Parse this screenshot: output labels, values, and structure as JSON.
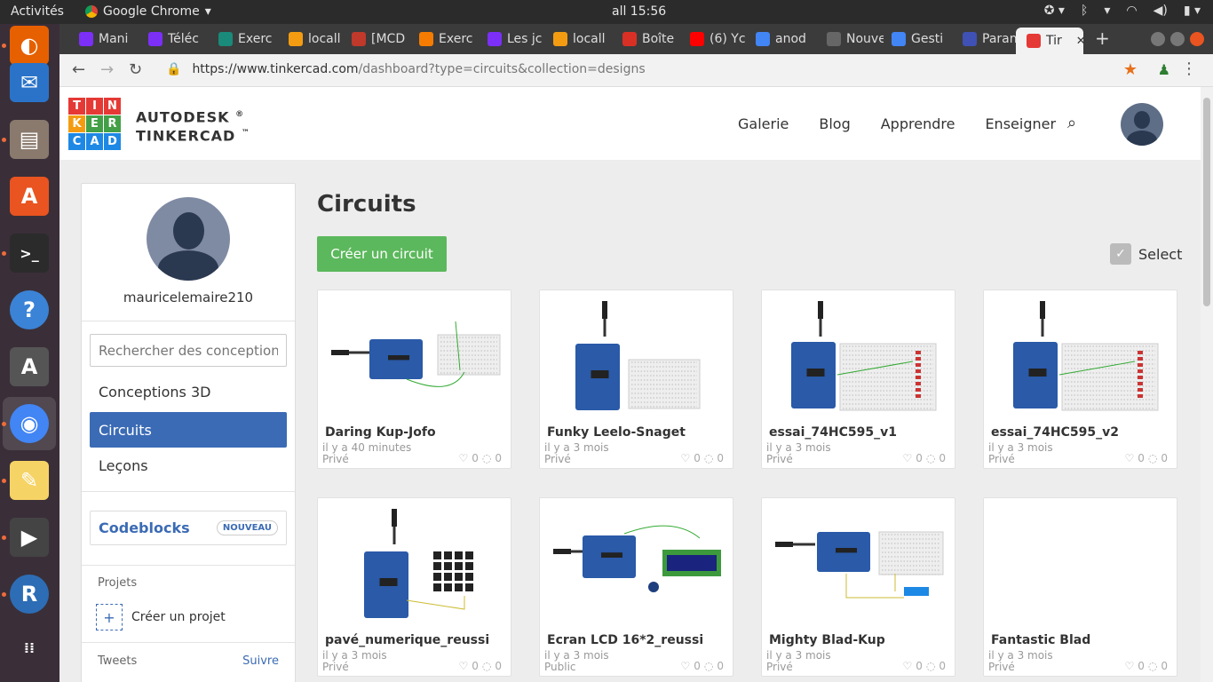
{
  "topbar": {
    "activities": "Activités",
    "app_name": "Google Chrome",
    "clock": "all 15:56"
  },
  "dock": {
    "items": [
      {
        "name": "firefox-icon",
        "color": "#e66000"
      },
      {
        "name": "thunderbird-icon",
        "color": "#2a73c9"
      },
      {
        "name": "files-icon",
        "color": "#8a7a6e"
      },
      {
        "name": "software-center-icon",
        "color": "#e95420"
      },
      {
        "name": "terminal-icon",
        "color": "#2b2b2b"
      },
      {
        "name": "help-icon",
        "color": "#3a83d6"
      },
      {
        "name": "updater-icon",
        "color": "#555"
      },
      {
        "name": "chrome-icon",
        "color": "#4285f4"
      },
      {
        "name": "text-editor-icon",
        "color": "#f6d365"
      },
      {
        "name": "video-editor-icon",
        "color": "#444"
      },
      {
        "name": "r-icon",
        "color": "#2d6db5"
      },
      {
        "name": "apps-grid-icon",
        "color": "#3a2f38"
      }
    ]
  },
  "tabs": [
    {
      "label": "Mani",
      "color": "#7b2ff7"
    },
    {
      "label": "Téléc",
      "color": "#7b2ff7"
    },
    {
      "label": "Exerc",
      "color": "#1a8a7a"
    },
    {
      "label": "locall",
      "color": "#f39c12"
    },
    {
      "label": "[MCD",
      "color": "#c0392b"
    },
    {
      "label": "Exerc",
      "color": "#f57c00"
    },
    {
      "label": "Les jc",
      "color": "#7b2ff7"
    },
    {
      "label": "locall",
      "color": "#f39c12"
    },
    {
      "label": "Boîte",
      "color": "#d93025"
    },
    {
      "label": "(6) Yc",
      "color": "#ff0000"
    },
    {
      "label": "anod",
      "color": "#4285f4"
    },
    {
      "label": "Nouvel c",
      "color": "#666"
    },
    {
      "label": "Gesti",
      "color": "#4285f4"
    },
    {
      "label": "Paran",
      "color": "#3f51b5"
    },
    {
      "label": "Tir",
      "color": "#e53935"
    }
  ],
  "browser": {
    "url_main": "https://www.tinkercad.com",
    "url_rest": "/dashboard?type=circuits&collection=designs"
  },
  "logo": {
    "letters": [
      "T",
      "I",
      "N",
      "K",
      "E",
      "R",
      "C",
      "A",
      "D"
    ],
    "colors": [
      "#e53935",
      "#e53935",
      "#e53935",
      "#f39c12",
      "#43a047",
      "#43a047",
      "#1e88e5",
      "#1e88e5",
      "#1e88e5"
    ]
  },
  "brand": {
    "line1": "AUTODESK",
    "line2": "TINKERCAD",
    "reg": "®",
    "tm": "™"
  },
  "nav": {
    "galerie": "Galerie",
    "blog": "Blog",
    "apprendre": "Apprendre",
    "enseigner": "Enseigner"
  },
  "sidebar": {
    "username": "mauricelemaire210",
    "search_placeholder": "Rechercher des conception",
    "menu": [
      "Conceptions 3D",
      "Circuits",
      "Leçons"
    ],
    "codeblocks": "Codeblocks",
    "badge": "NOUVEAU",
    "projects_title": "Projets",
    "create_project": "Créer un projet",
    "tweets": "Tweets",
    "follow": "Suivre"
  },
  "main": {
    "title": "Circuits",
    "create_button": "Créer un circuit",
    "select_label": "Select"
  },
  "cards": [
    {
      "name": "Daring Kup-Jofo",
      "time": "il y a 40 minutes",
      "visibility": "Privé",
      "likes": "0",
      "comments": "0"
    },
    {
      "name": "Funky Leelo-Snaget",
      "time": "il y a 3 mois",
      "visibility": "Privé",
      "likes": "0",
      "comments": "0"
    },
    {
      "name": "essai_74HC595_v1",
      "time": "il y a 3 mois",
      "visibility": "Privé",
      "likes": "0",
      "comments": "0"
    },
    {
      "name": "essai_74HC595_v2",
      "time": "il y a 3 mois",
      "visibility": "Privé",
      "likes": "0",
      "comments": "0"
    },
    {
      "name": "pavé_numerique_reussi",
      "time": "il y a 3 mois",
      "visibility": "Privé",
      "likes": "0",
      "comments": "0"
    },
    {
      "name": "Ecran LCD 16*2_reussi",
      "time": "il y a 3 mois",
      "visibility": "Public",
      "likes": "0",
      "comments": "0"
    },
    {
      "name": "Mighty Blad-Kup",
      "time": "il y a 3 mois",
      "visibility": "Privé",
      "likes": "0",
      "comments": "0"
    },
    {
      "name": "Fantastic Blad",
      "time": "il y a 3 mois",
      "visibility": "Privé",
      "likes": "0",
      "comments": "0"
    }
  ]
}
